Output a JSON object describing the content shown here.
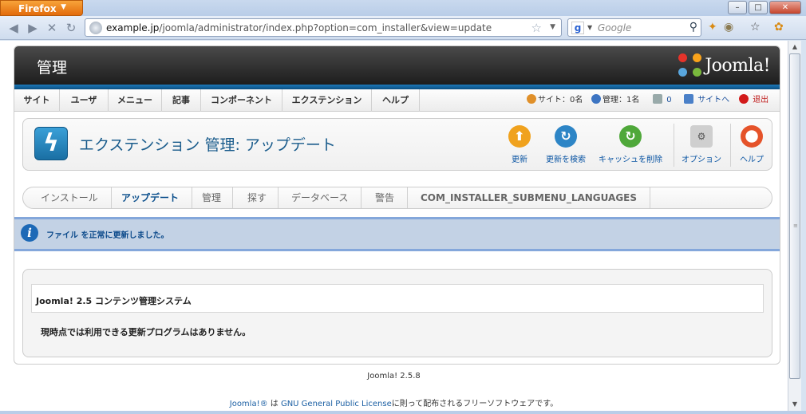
{
  "browser": {
    "menu_button": "Firefox",
    "url_domain": "example.jp",
    "url_path": "/joomla/administrator/index.php?option=com_installer&view=update",
    "search_placeholder": "Google"
  },
  "header": {
    "title": "管理",
    "logo_text": "Joomla!"
  },
  "menu": {
    "items": [
      "サイト",
      "ユーザ",
      "メニュー",
      "記事",
      "コンポーネント",
      "エクステンション",
      "ヘルプ"
    ]
  },
  "status": {
    "site_users": "サイト：0名",
    "admin_users": "管理：1名",
    "messages": "0",
    "view_site": "サイトへ",
    "logout": "退出"
  },
  "toolbar": {
    "page_title": "エクステンション 管理: アップデート",
    "buttons": [
      "更新",
      "更新を検索",
      "キャッシュを削除",
      "オプション",
      "ヘルプ"
    ]
  },
  "submenu": {
    "items": [
      "インストール",
      "アップデート",
      "管理",
      "探す",
      "データベース",
      "警告",
      "COM_INSTALLER_SUBMENU_LANGUAGES"
    ]
  },
  "message": {
    "text": "ファイル を正常に更新しました。"
  },
  "panel": {
    "table_caption": "Joomla! 2.5 コンテンツ管理システム",
    "note": "現時点では利用できる更新プログラムはありません。"
  },
  "footer": {
    "version": "Joomla! 2.5.8",
    "link1": "Joomla!®",
    "mid1": " は ",
    "link2": "GNU General Public License",
    "tail": "に則って配布されるフリーソフトウェアです。"
  },
  "colors": {
    "header_bar": "#0b4f82",
    "link": "#1b5fa3",
    "message_bg": "#c3d2e5"
  }
}
